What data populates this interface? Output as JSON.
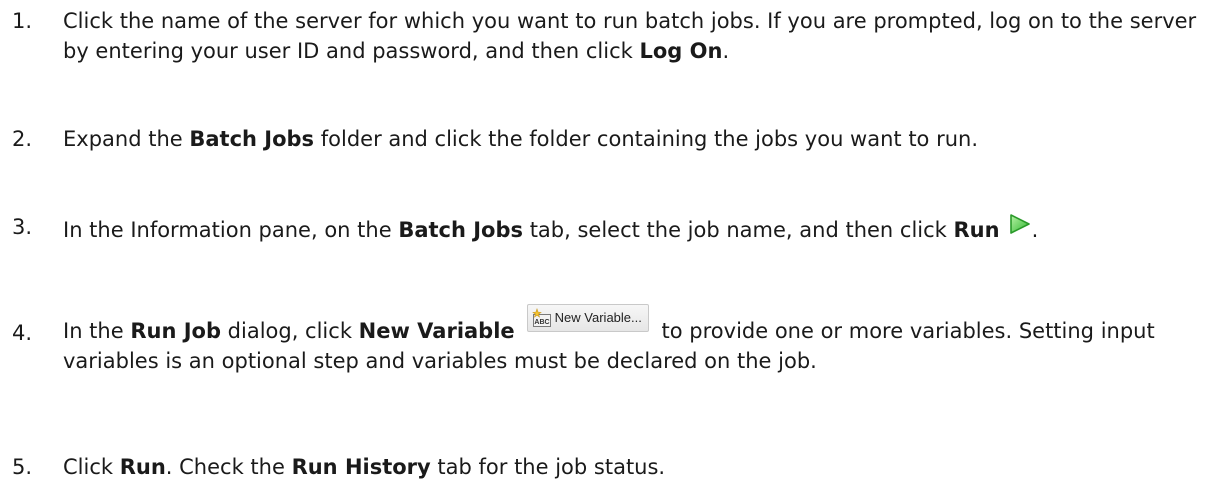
{
  "steps": [
    {
      "number": "1.",
      "parts": {
        "text_a": "Click the name of the server for which you want to run batch jobs. If you are prompted, log on to the server by entering your user ID and password, and then click ",
        "bold_a": "Log On",
        "text_b": "."
      }
    },
    {
      "number": "2.",
      "parts": {
        "text_a": "Expand the ",
        "bold_a": "Batch Jobs",
        "text_b": " folder and click the folder containing the jobs you want to run."
      }
    },
    {
      "number": "3.",
      "parts": {
        "text_a": "In the Information pane, on the ",
        "bold_a": "Batch Jobs",
        "text_b": " tab, select the job name, and then click ",
        "bold_b": "Run",
        "text_c": "."
      },
      "icon": "run-icon",
      "icon_color": "#2db62d"
    },
    {
      "number": "4.",
      "parts": {
        "text_a": "In the ",
        "bold_a": "Run Job",
        "text_b": " dialog, click ",
        "bold_b": "New Variable",
        "text_c": " to provide one or more variables. Setting input variables is an optional step and variables must be declared on the job."
      },
      "button": {
        "label": "New Variable...",
        "icon": "new-variable-icon"
      }
    },
    {
      "number": "5.",
      "parts": {
        "text_a": "Click ",
        "bold_a": "Run",
        "text_b": ". Check the ",
        "bold_b": "Run History",
        "text_c": " tab for the job status."
      }
    }
  ]
}
